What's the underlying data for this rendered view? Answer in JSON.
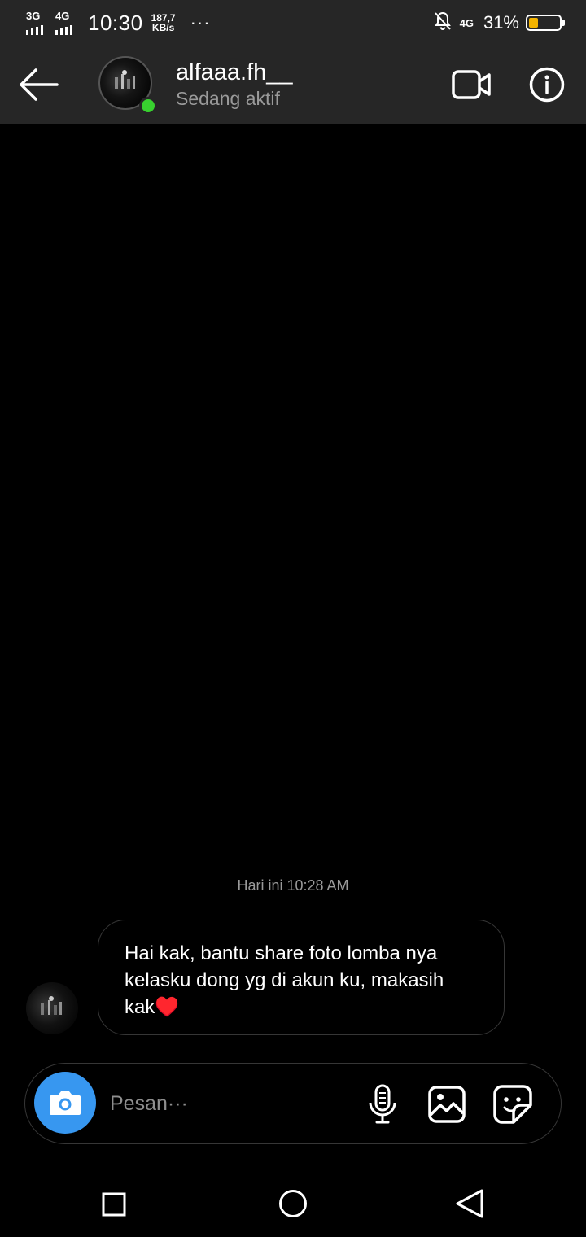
{
  "status_bar": {
    "network1": "3G",
    "network2": "4G",
    "time": "10:30",
    "speed_value": "187,7",
    "speed_unit": "KB/s",
    "more": "···",
    "right_network": "4G",
    "battery_text": "31%",
    "battery_level": 0.31,
    "battery_color": "#f4b400"
  },
  "header": {
    "username": "alfaaa.fh__",
    "status": "Sedang aktif",
    "online_color": "#38d12f",
    "icons": [
      "back-arrow-icon",
      "video-call-icon",
      "info-icon"
    ]
  },
  "conversation": {
    "timestamp": "Hari ini 10:28 AM",
    "messages": [
      {
        "text": "Hai kak, bantu share foto lomba nya kelasku dong yg di akun ku, makasih kak",
        "emoji": "♥️"
      }
    ]
  },
  "composer": {
    "placeholder": "Pesan···",
    "accent_color": "#3797f0",
    "icons": [
      "camera-icon",
      "microphone-icon",
      "gallery-icon",
      "sticker-icon"
    ]
  },
  "nav_bar": {
    "icons": [
      "recent-apps-icon",
      "home-icon",
      "back-icon"
    ]
  }
}
